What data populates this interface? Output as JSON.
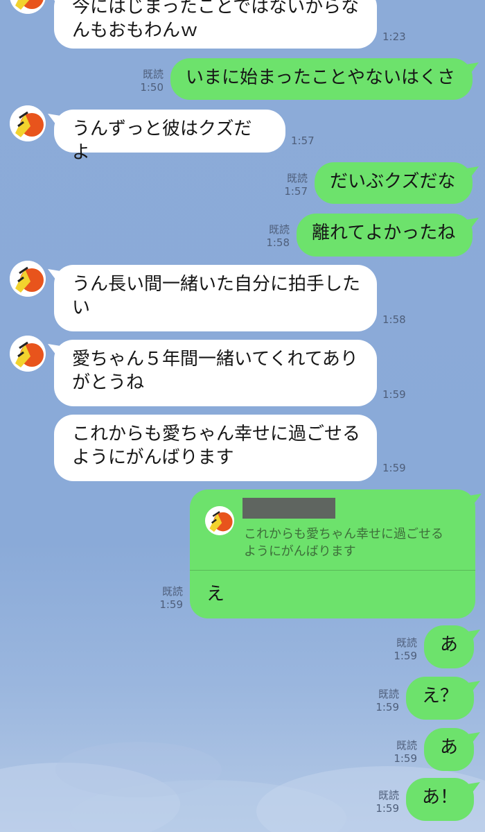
{
  "read_label": "既読",
  "colors": {
    "background": "#8cabd8",
    "incoming_bubble": "#ffffff",
    "outgoing_bubble": "#6de26c",
    "meta_text": "#4e5e7a"
  },
  "messages": [
    {
      "direction": "in",
      "lines": [
        "今にはじまったことではないからな",
        "んもおもわんｗ"
      ],
      "time": "1:23"
    },
    {
      "direction": "out",
      "text": "いまに始まったことやないはくさ",
      "read": "既読",
      "time": "1:50"
    },
    {
      "direction": "in",
      "text": "うんずっと彼はクズだよ",
      "time": "1:57"
    },
    {
      "direction": "out",
      "text": "だいぶクズだな",
      "read": "既読",
      "time": "1:57"
    },
    {
      "direction": "out",
      "text": "離れてよかったね",
      "read": "既読",
      "time": "1:58"
    },
    {
      "direction": "in",
      "lines": [
        "うん長い間一緒いた自分に拍手した",
        "い"
      ],
      "time": "1:58"
    },
    {
      "direction": "in",
      "lines": [
        "愛ちゃん５年間一緒いてくれてあり",
        "がとうね"
      ],
      "time": "1:59"
    },
    {
      "direction": "in",
      "lines": [
        "これからも愛ちゃん幸せに過ごせる",
        "ようにがんばります"
      ],
      "time": "1:59"
    },
    {
      "direction": "out",
      "text": "え",
      "read": "既読",
      "time": "1:59",
      "reply_to": {
        "lines": [
          "これからも愛ちゃん幸せに過ごせる",
          "ようにがんばります"
        ]
      }
    },
    {
      "direction": "out",
      "text": "あ",
      "read": "既読",
      "time": "1:59"
    },
    {
      "direction": "out",
      "text": "え？",
      "read": "既読",
      "time": "1:59"
    },
    {
      "direction": "out",
      "text": "あ",
      "read": "既読",
      "time": "1:59"
    },
    {
      "direction": "out",
      "text": "あ！",
      "read": "既読",
      "time": "1:59"
    }
  ]
}
